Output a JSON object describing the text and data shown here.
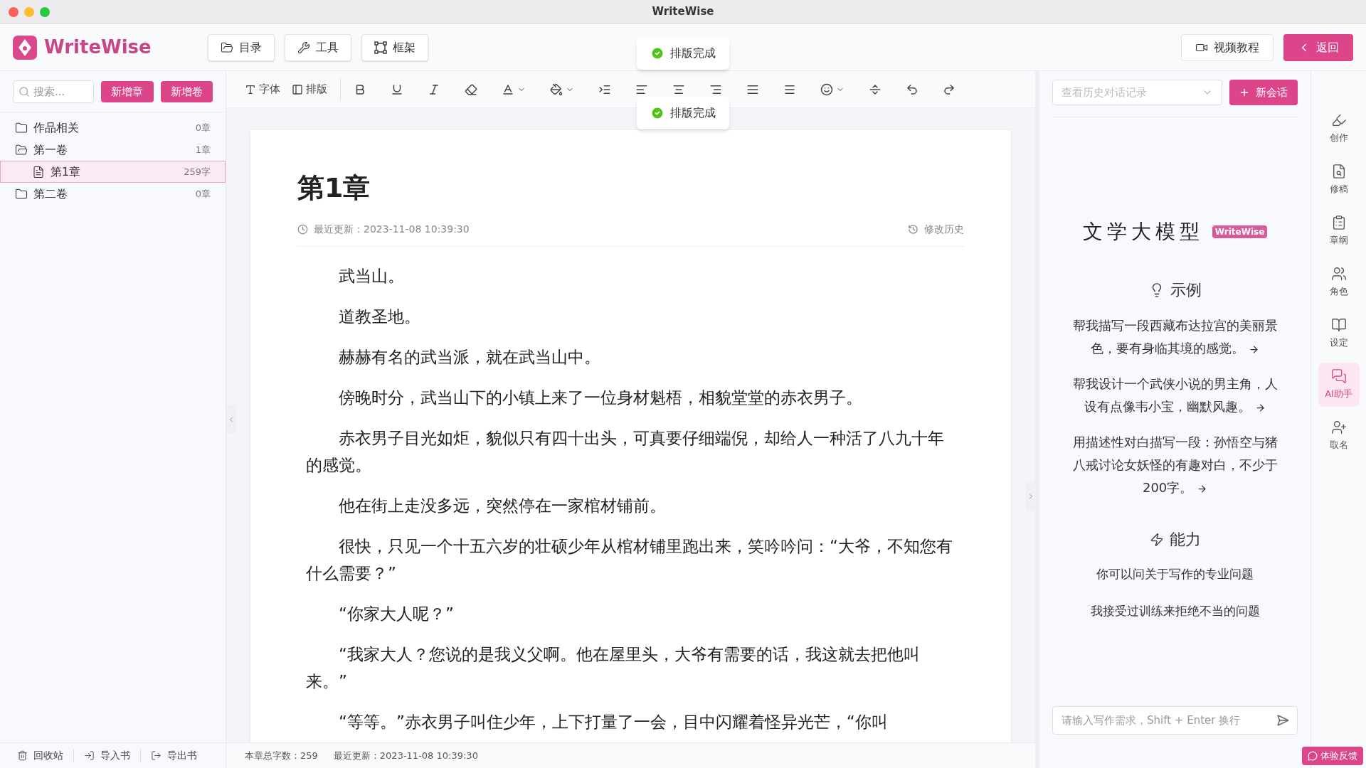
{
  "window": {
    "title": "WriteWise"
  },
  "app": {
    "logo": "WriteWise"
  },
  "header_buttons": [
    {
      "label": "目录"
    },
    {
      "label": "工具"
    },
    {
      "label": "框架"
    }
  ],
  "header_right": [
    {
      "label": "视频教程",
      "kind": "outline"
    },
    {
      "label": "返回",
      "kind": "primary"
    }
  ],
  "toasts": [
    {
      "message": "排版完成"
    },
    {
      "message": "排版完成"
    }
  ],
  "sidebar": {
    "search": {
      "placeholder": "搜索..."
    },
    "buttons": [
      "新增章",
      "新增卷"
    ],
    "tree": [
      {
        "label": "作品相关",
        "count": "0章",
        "expanded": false,
        "selected": false
      },
      {
        "label": "第一卷",
        "count": "1章",
        "expanded": true,
        "selected": false,
        "children": [
          {
            "label": "第1章",
            "count": "259字",
            "selected": true
          }
        ]
      },
      {
        "label": "第二卷",
        "count": "0章",
        "expanded": false,
        "selected": false
      }
    ],
    "footer": [
      "回收站",
      "导入书",
      "导出书"
    ]
  },
  "toolbar": {
    "text_buttons": [
      "字体",
      "排版"
    ]
  },
  "editor": {
    "title": "第1章",
    "updated": "最近更新：2023-11-08 10:39:30",
    "history": "修改历史",
    "paragraphs": [
      "武当山。",
      "道教圣地。",
      "赫赫有名的武当派，就在武当山中。",
      "傍晚时分，武当山下的小镇上来了一位身材魁梧，相貌堂堂的赤衣男子。",
      "赤衣男子目光如炬，貌似只有四十出头，可真要仔细端倪，却给人一种活了八九十年的感觉。",
      "他在街上走没多远，突然停在一家棺材铺前。",
      "很快，只见一个十五六岁的壮硕少年从棺材铺里跑出来，笑吟吟问：“大爷，不知您有什么需要？”",
      "“你家大人呢？”",
      "“我家大人？您说的是我义父啊。他在屋里头，大爷有需要的话，我这就去把他叫来。”",
      "“等等。”赤衣男子叫住少年，上下打量了一会，目中闪耀着怪异光芒，“你叫"
    ]
  },
  "ai_panel": {
    "history_select": {
      "placeholder": "查看历史对话记录"
    },
    "new_chat": "新会话",
    "heading": "文学大模型",
    "badge": "WriteWise",
    "examples_title": "示例",
    "examples": [
      "帮我描写一段西藏布达拉宫的美丽景色，要有身临其境的感觉。",
      "帮我设计一个武侠小说的男主角，人设有点像韦小宝，幽默风趣。",
      "用描述性对白描写一段：孙悟空与猪八戒讨论女妖怪的有趣对白，不少于200字。"
    ],
    "abilities_title": "能力",
    "abilities": [
      "你可以问关于写作的专业问题",
      "我接受过训练来拒绝不当的问题"
    ],
    "input": {
      "placeholder": "请输入写作需求，Shift + Enter 换行"
    }
  },
  "right_rail": [
    {
      "label": "创作",
      "selected": false
    },
    {
      "label": "修稿",
      "selected": false
    },
    {
      "label": "章纲",
      "selected": false
    },
    {
      "label": "角色",
      "selected": false
    },
    {
      "label": "设定",
      "selected": false
    },
    {
      "label": "AI助手",
      "selected": true
    },
    {
      "label": "取名",
      "selected": false
    }
  ],
  "status_bar": {
    "word_count": "本章总字数：259",
    "updated": "最近更新：2023-11-08 10:39:30"
  },
  "feedback_button": "体验反馈"
}
